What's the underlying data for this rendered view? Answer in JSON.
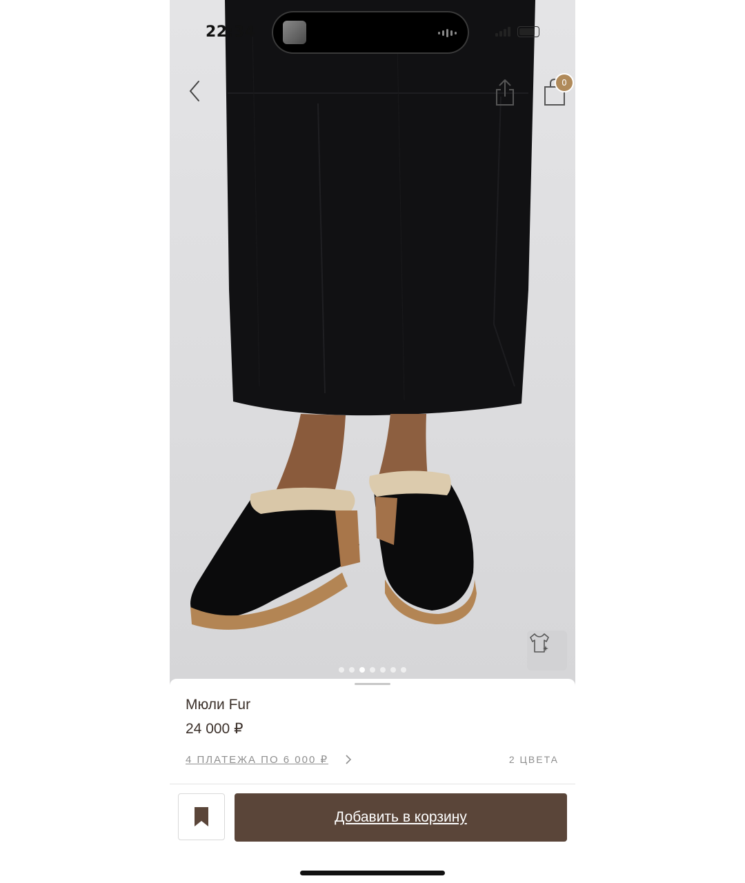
{
  "status_bar": {
    "time": "22:34"
  },
  "nav": {
    "back_icon": "chevron-left-icon",
    "share_icon": "share-icon",
    "cart_icon": "shopping-bag-icon",
    "cart_count": "0",
    "badge_color": "#b08a5a"
  },
  "gallery": {
    "image_count": 7,
    "active_index": 2,
    "tryon_icon": "tshirt-sparkle-icon"
  },
  "product": {
    "title": "Мюли Fur",
    "price": "24 000 ₽",
    "installments": "4 ПЛАТЕЖА ПО 6 000 ₽",
    "colors": "2 ЦВЕТА"
  },
  "actions": {
    "favorite_icon": "bookmark-icon",
    "add_to_cart_label": "Добавить в корзину",
    "button_color": "#5a4539"
  }
}
